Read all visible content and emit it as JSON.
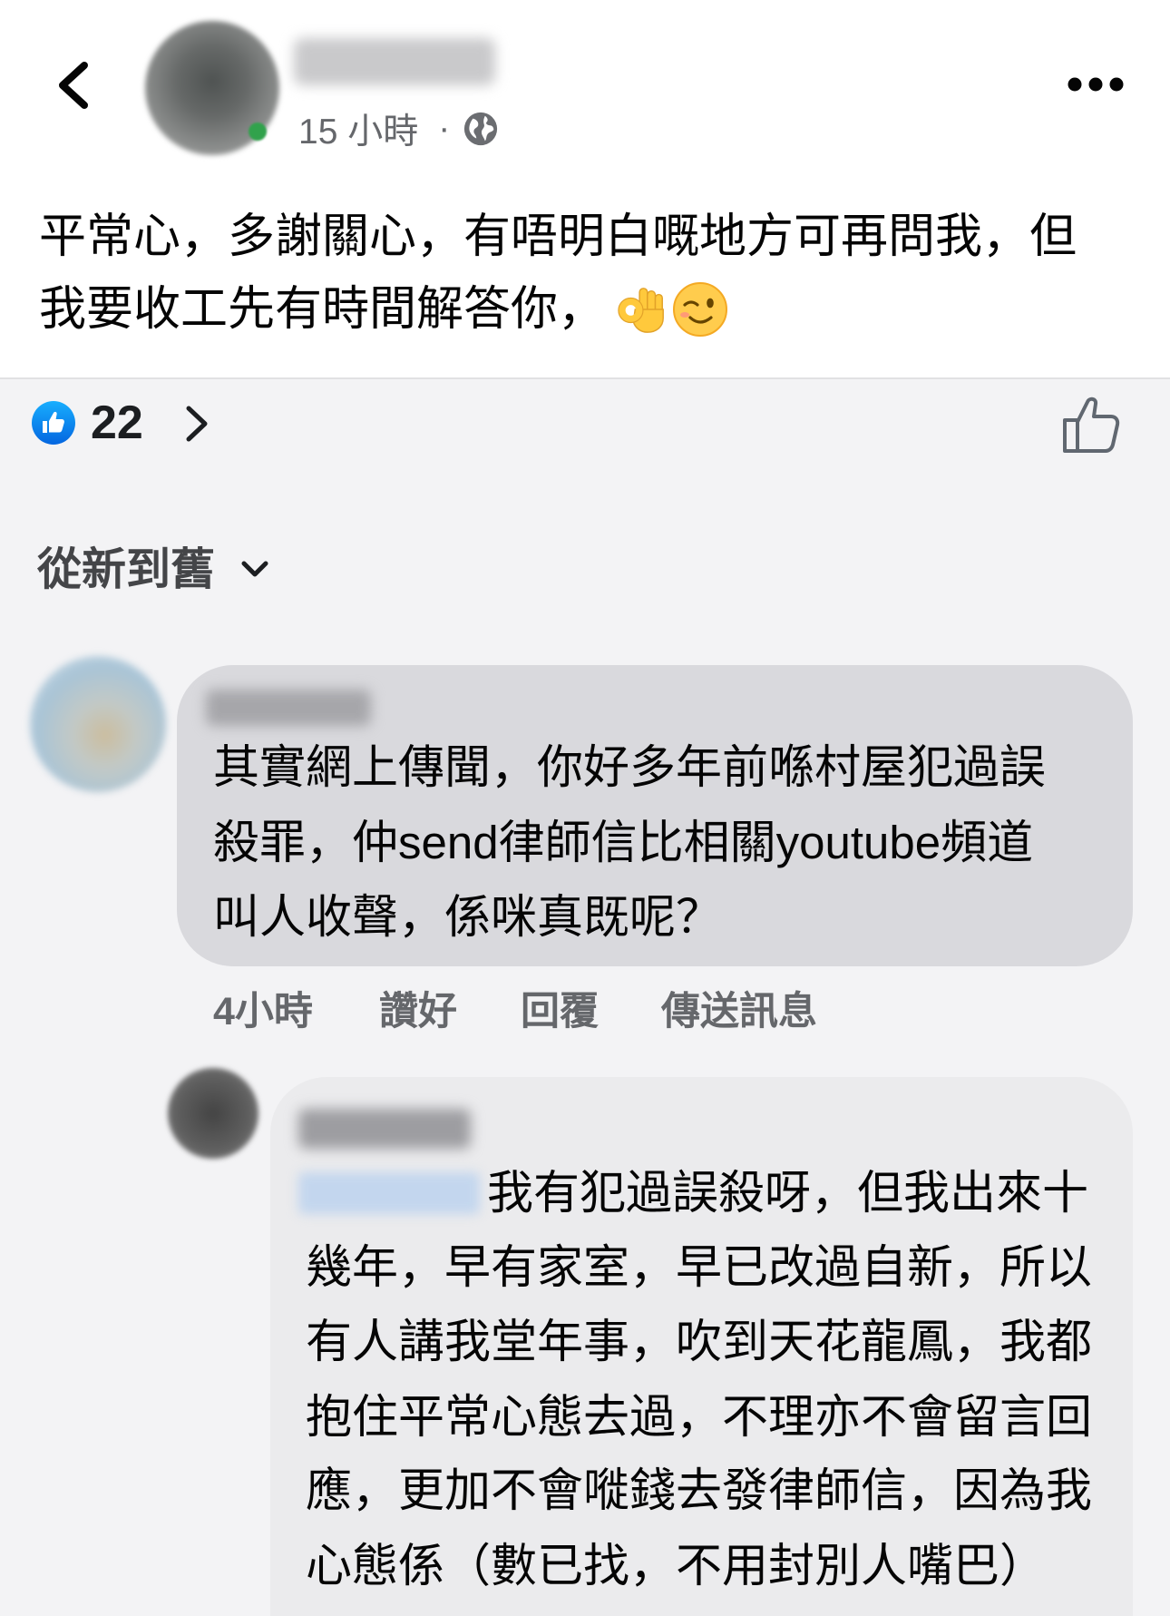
{
  "header": {
    "back_icon": "chevron-left-icon",
    "timestamp": "15 小時",
    "separator": "·",
    "privacy_icon": "globe-icon",
    "more_icon": "more-horizontal-icon"
  },
  "post": {
    "text_lines": [
      "平常心，多謝關心，有唔明白嘅地方可再問我，但",
      "我要收工先有時間解答你，"
    ],
    "emojis": [
      "ok-hand-emoji",
      "winking-face-emoji"
    ]
  },
  "reactions": {
    "icon": "like-reaction-icon",
    "count": "22",
    "like_button_icon": "thumbs-up-outline-icon"
  },
  "comments_sort": {
    "label": "從新到舊",
    "icon": "chevron-down-icon"
  },
  "comments": [
    {
      "text_lines": [
        "其實網上傳聞，你好多年前喺村屋犯過誤",
        "殺罪，仲send律師信比相關youtube頻道",
        "叫人收聲，係咪真既呢？"
      ],
      "time": "4小時",
      "like_label": "讚好",
      "reply_label": "回覆",
      "message_label": "傳送訊息",
      "replies": [
        {
          "text_lines": [
            "我有犯過誤殺呀，但我出來十",
            "幾年，早有家室，早已改過自新，所以",
            "有人講我堂年事，吹到天花龍鳳，我都",
            "抱住平常心態去過，不理亦不會留言回",
            "應，更加不會嘥錢去發律師信，因為我",
            "心態係（數已找，不用封別人嘴巴）"
          ]
        }
      ]
    }
  ],
  "colors": {
    "like_blue": "#1877f2",
    "online_green": "#31a24c",
    "comment_bubble": "#d9d9dd",
    "reply_bubble": "#ebebed",
    "secondary_text": "#65676b"
  }
}
